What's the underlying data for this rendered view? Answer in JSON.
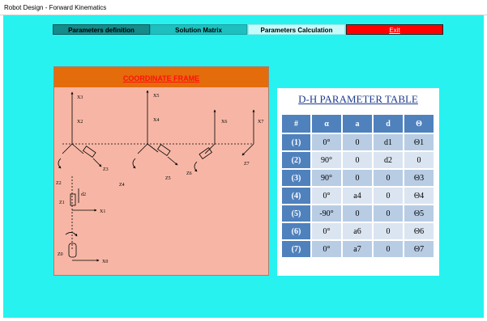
{
  "window": {
    "title": "Robot Design - Forward Kinematics"
  },
  "tabs": [
    {
      "label": "Parameters definition"
    },
    {
      "label": "Solution Matrix"
    },
    {
      "label": "Parameters Calculation"
    },
    {
      "label": "Exit"
    }
  ],
  "coordinate_frame": {
    "title": "COORDINATE FRAME",
    "labels": {
      "x0": "X0",
      "x1": "X1",
      "x2": "X2",
      "x3": "X3",
      "x4": "X4",
      "x5": "X5",
      "x6": "X6",
      "x7": "X7",
      "z0": "Z0",
      "z1": "Z1",
      "z2": "Z2",
      "z3": "Z3",
      "z4": "Z4",
      "z5": "Z5",
      "z6": "Z6",
      "z7": "Z7",
      "d2": "d2"
    }
  },
  "dh_table": {
    "title": "D-H PARAMETER TABLE",
    "headers": [
      "#",
      "α",
      "a",
      "d",
      "Θ"
    ],
    "rows": [
      {
        "id": "(1)",
        "alpha": "0°",
        "a": "0",
        "d": "d1",
        "theta": "Θ1"
      },
      {
        "id": "(2)",
        "alpha": "90°",
        "a": "0",
        "d": "d2",
        "theta": "0"
      },
      {
        "id": "(3)",
        "alpha": "90°",
        "a": "0",
        "d": "0",
        "theta": "Θ3"
      },
      {
        "id": "(4)",
        "alpha": "0°",
        "a": "a4",
        "d": "0",
        "theta": "Θ4"
      },
      {
        "id": "(5)",
        "alpha": "-90°",
        "a": "0",
        "d": "0",
        "theta": "Θ5"
      },
      {
        "id": "(6)",
        "alpha": "0°",
        "a": "a6",
        "d": "0",
        "theta": "Θ6"
      },
      {
        "id": "(7)",
        "alpha": "0°",
        "a": "a7",
        "d": "0",
        "theta": "Θ7"
      }
    ]
  },
  "colors": {
    "background": "#27f2f0",
    "header": "#4f81bd",
    "exit": "#ff0000",
    "frame_head": "#e46c0a",
    "frame_body": "#f7b6a5"
  }
}
